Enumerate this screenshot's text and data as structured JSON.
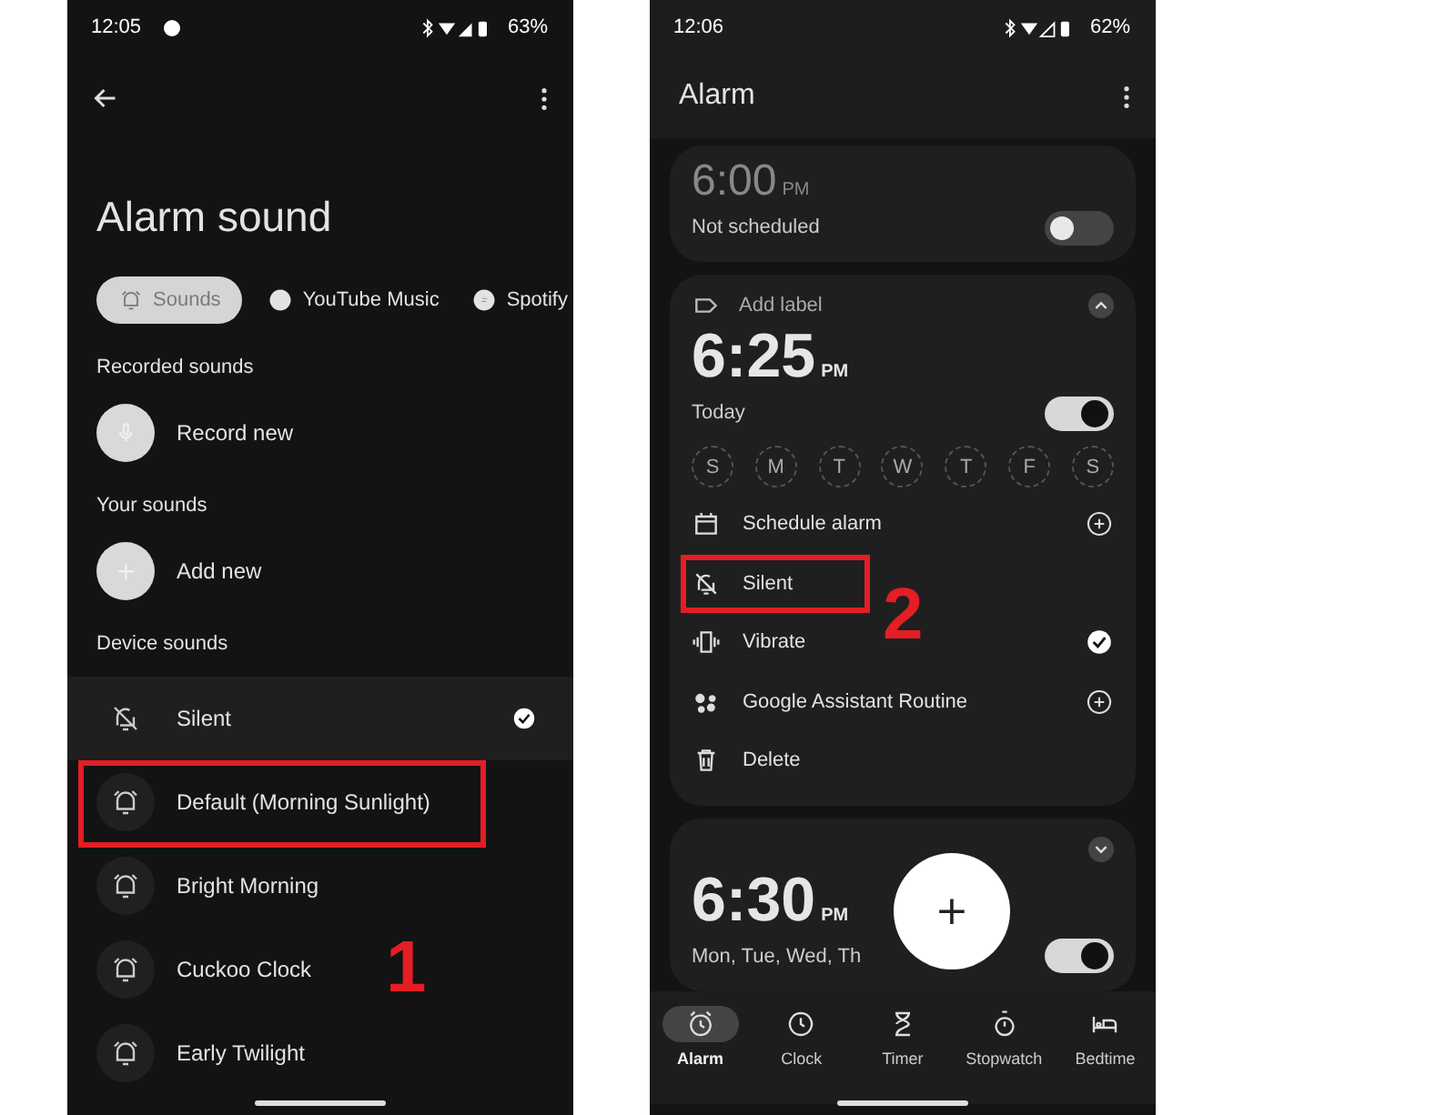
{
  "left_screen": {
    "status_bar": {
      "time": "12:05",
      "battery": "63%"
    },
    "title": "Alarm sound",
    "chips": [
      {
        "label": "Sounds",
        "selected": true,
        "kind": "sounds"
      },
      {
        "label": "YouTube Music",
        "selected": false,
        "kind": "youtube"
      },
      {
        "label": "Spotify",
        "selected": false,
        "kind": "spotify"
      }
    ],
    "sections": [
      {
        "heading": "Recorded sounds",
        "action": "Record new",
        "kind": "record"
      },
      {
        "heading": "Your sounds",
        "action": "Add new",
        "kind": "add"
      }
    ],
    "device_heading": "Device sounds",
    "device_sounds": [
      {
        "label": "Silent",
        "kind": "silent",
        "selected": true,
        "highlighted": false
      },
      {
        "label": "Default (Morning Sunlight)",
        "kind": "tone",
        "selected": false,
        "highlighted": true
      },
      {
        "label": "Bright Morning",
        "kind": "tone",
        "selected": false,
        "highlighted": false
      },
      {
        "label": "Cuckoo Clock",
        "kind": "tone",
        "selected": false,
        "highlighted": false
      },
      {
        "label": "Early Twilight",
        "kind": "tone",
        "selected": false,
        "highlighted": false
      }
    ],
    "annotation_number": "1"
  },
  "right_screen": {
    "status_bar": {
      "time": "12:06",
      "battery": "62%"
    },
    "title": "Alarm",
    "alarms": [
      {
        "time": "6:00",
        "period": "PM",
        "schedule": "Not scheduled",
        "on": false,
        "expanded": false,
        "kind": "collapsed-top"
      },
      {
        "label": "Add label",
        "time": "6:25",
        "period": "PM",
        "schedule": "Today",
        "on": true,
        "expanded": true,
        "kind": "full",
        "days": [
          {
            "label": "S",
            "selected": false
          },
          {
            "label": "M",
            "selected": false
          },
          {
            "label": "T",
            "selected": false
          },
          {
            "label": "W",
            "selected": false
          },
          {
            "label": "T",
            "selected": false
          },
          {
            "label": "F",
            "selected": false
          },
          {
            "label": "S",
            "selected": false
          }
        ],
        "options": [
          {
            "label": "Schedule alarm",
            "kind": "schedule",
            "highlighted": false
          },
          {
            "label": "Silent",
            "kind": "silent",
            "highlighted": true
          },
          {
            "label": "Vibrate",
            "kind": "vibrate",
            "checked": true,
            "highlighted": false
          },
          {
            "label": "Google Assistant Routine",
            "kind": "assistant",
            "highlighted": false
          },
          {
            "label": "Delete",
            "kind": "delete",
            "highlighted": false
          }
        ]
      },
      {
        "time": "6:30",
        "period": "PM",
        "schedule": "Mon, Tue, Wed, Th",
        "on": true,
        "expanded": false,
        "kind": "full"
      }
    ],
    "fab": "+",
    "nav": [
      {
        "label": "Alarm",
        "kind": "alarm",
        "selected": true
      },
      {
        "label": "Clock",
        "kind": "clock",
        "selected": false
      },
      {
        "label": "Timer",
        "kind": "timer",
        "selected": false
      },
      {
        "label": "Stopwatch",
        "kind": "stopwatch",
        "selected": false
      },
      {
        "label": "Bedtime",
        "kind": "bedtime",
        "selected": false
      }
    ],
    "annotation_number": "2"
  }
}
